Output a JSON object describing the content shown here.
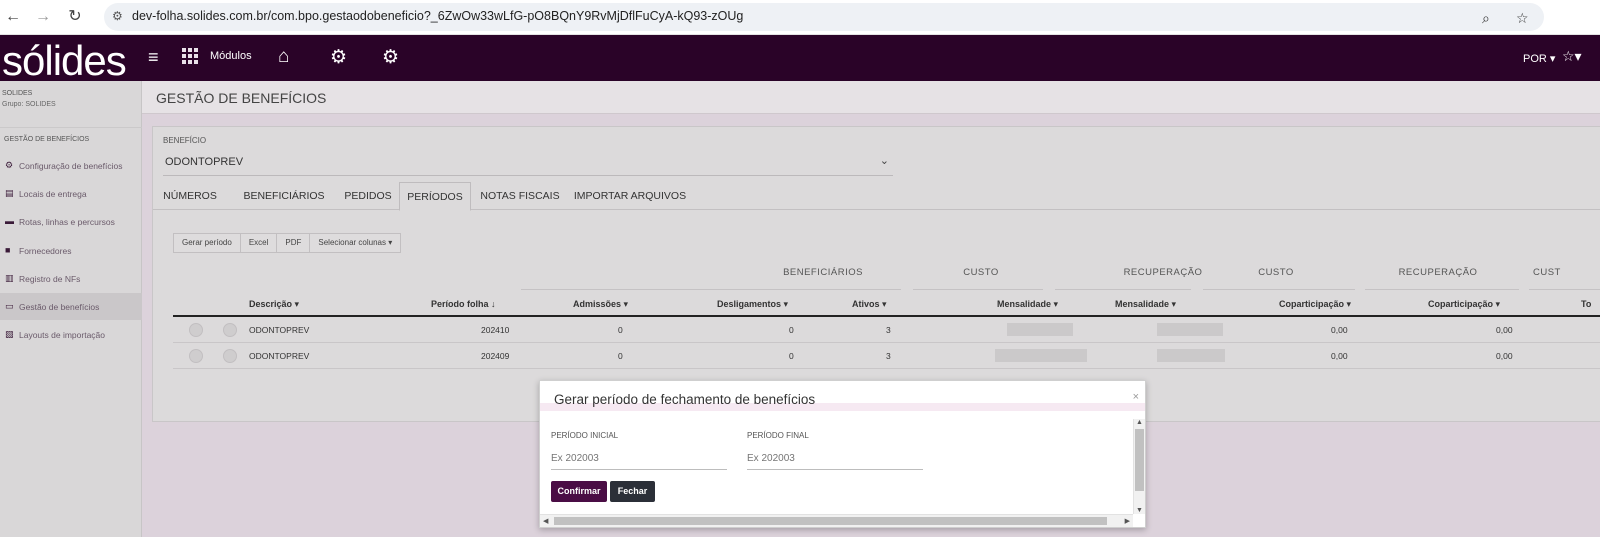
{
  "browser": {
    "url": "dev-folha.solides.com.br/com.bpo.gestaodobeneficio?_6ZwOw33wLfG-pO8BQnY9RvMjDflFuCyA-kQ93-zOUg"
  },
  "header": {
    "logo": "sólides",
    "modules_label": "Módulos",
    "language": "POR"
  },
  "sidebar": {
    "company": "SOLIDES",
    "group": "Grupo: SOLIDES",
    "section": "GESTÃO DE BENEFÍCIOS",
    "items": [
      {
        "label": "Configuração de benefícios",
        "icon": "gear-icon"
      },
      {
        "label": "Locais de entrega",
        "icon": "cart-icon"
      },
      {
        "label": "Rotas, linhas e percursos",
        "icon": "bus-icon"
      },
      {
        "label": "Fornecedores",
        "icon": "briefcase-icon"
      },
      {
        "label": "Registro de NFs",
        "icon": "document-icon"
      },
      {
        "label": "Gestão de benefícios",
        "icon": "card-icon"
      },
      {
        "label": "Layouts de importação",
        "icon": "import-icon"
      }
    ]
  },
  "page": {
    "title": "GESTÃO DE BENEFÍCIOS",
    "benefit_label": "BENEFÍCIO",
    "benefit_value": "ODONTOPREV"
  },
  "tabs": [
    "NÚMEROS",
    "BENEFICIÁRIOS",
    "PEDIDOS",
    "PERÍODOS",
    "NOTAS FISCAIS",
    "IMPORTAR ARQUIVOS"
  ],
  "active_tab": "PERÍODOS",
  "toolbar": {
    "generate": "Gerar período",
    "excel": "Excel",
    "pdf": "PDF",
    "columns": "Selecionar colunas ▾"
  },
  "table": {
    "groups": [
      "BENEFICIÁRIOS",
      "CUSTO",
      "RECUPERAÇÃO",
      "CUSTO",
      "RECUPERAÇÃO",
      "CUST"
    ],
    "headers": {
      "descricao": "Descrição ▾",
      "periodo": "Período folha ↓",
      "admissoes": "Admissões ▾",
      "desligamentos": "Desligamentos ▾",
      "ativos": "Ativos ▾",
      "mensalidade_custo": "Mensalidade ▾",
      "mensalidade_rec": "Mensalidade ▾",
      "copart_custo": "Coparticipação ▾",
      "copart_rec": "Coparticipação ▾",
      "total": "To"
    },
    "rows": [
      {
        "descricao": "ODONTOPREV",
        "periodo": "202410",
        "admissoes": "0",
        "desligamentos": "0",
        "ativos": "3",
        "copart_custo": "0,00",
        "copart_rec": "0,00"
      },
      {
        "descricao": "ODONTOPREV",
        "periodo": "202409",
        "admissoes": "0",
        "desligamentos": "0",
        "ativos": "3",
        "copart_custo": "0,00",
        "copart_rec": "0,00"
      }
    ]
  },
  "modal": {
    "title": "Gerar período de fechamento de benefícios",
    "close": "×",
    "start_label": "PERÍODO INICIAL",
    "start_placeholder": "Ex 202003",
    "end_label": "PERÍODO FINAL",
    "end_placeholder": "Ex 202003",
    "confirm": "Confirmar",
    "close_button": "Fechar"
  },
  "colors": {
    "brand": "#2a0328",
    "confirm_button": "#4a0d45",
    "close_button": "#2b2f38"
  }
}
